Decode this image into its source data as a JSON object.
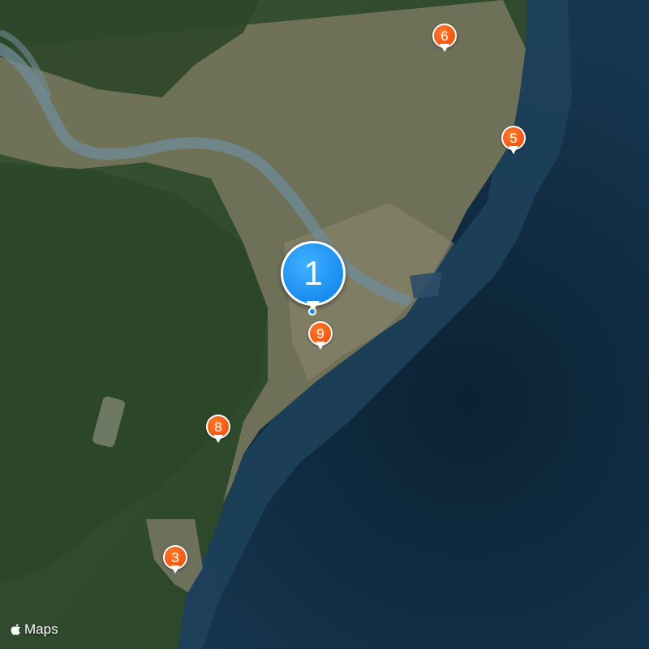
{
  "map": {
    "attribution": "Maps",
    "attribution_icon": "apple-logo-icon",
    "colors": {
      "ocean_deep": "#0d2438",
      "ocean_shelf": "#1d3d58",
      "land_green": "#2e4a2a",
      "urban": "#7c7a62",
      "river": "#6f8c98",
      "pin_orange": "#f2560f",
      "pin_blue": "#1a8cf0"
    }
  },
  "pins": [
    {
      "label": "1",
      "style": "blue"
    },
    {
      "label": "3",
      "style": "orange"
    },
    {
      "label": "5",
      "style": "orange"
    },
    {
      "label": "6",
      "style": "orange"
    },
    {
      "label": "8",
      "style": "orange"
    },
    {
      "label": "9",
      "style": "orange"
    }
  ]
}
